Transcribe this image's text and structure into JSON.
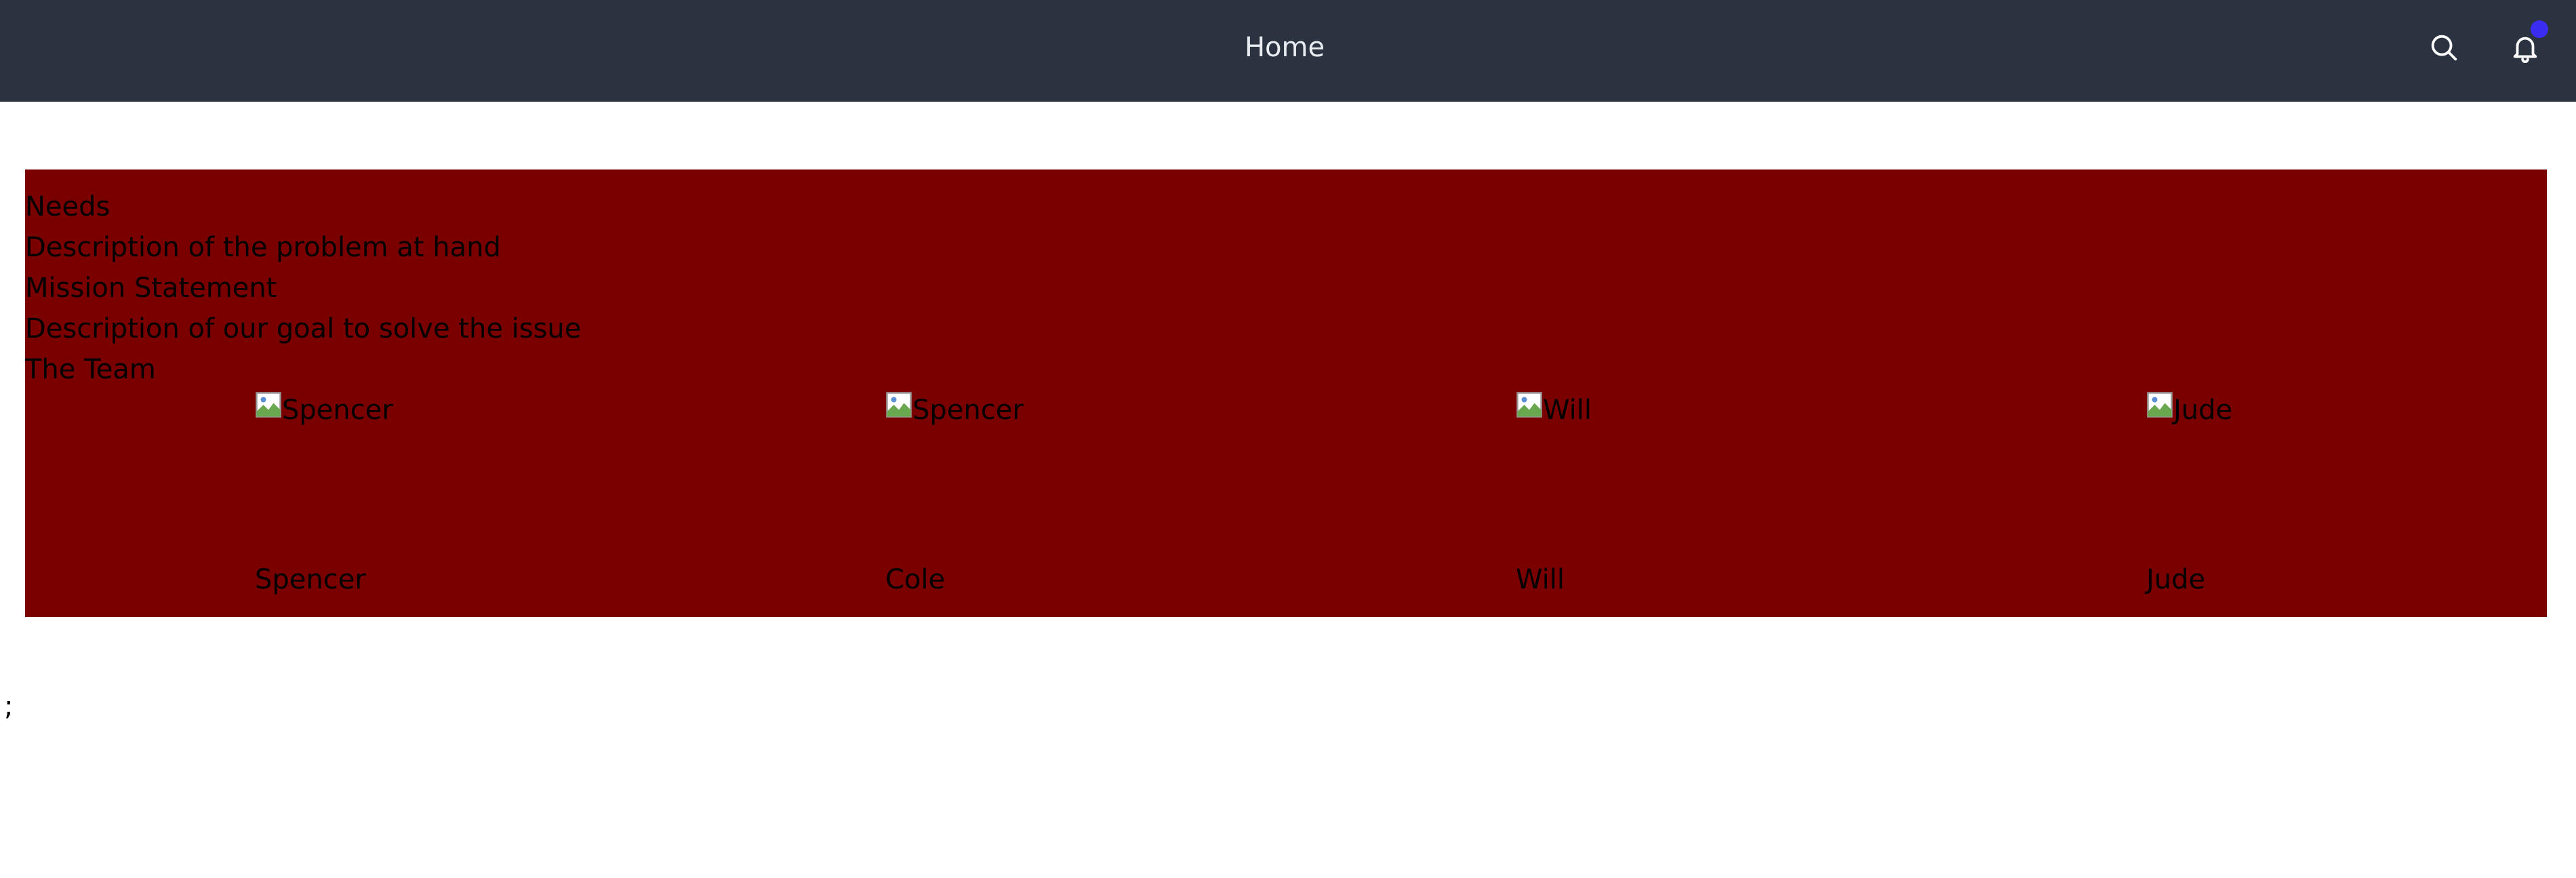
{
  "nav": {
    "title": "Home",
    "search_icon": "search-icon",
    "bell_icon": "bell-icon",
    "notification_dot_color": "#3a2cf0",
    "background_color": "#2b3340"
  },
  "panel": {
    "background_color": "#7a0000",
    "needs_heading": "Needs",
    "needs_text": "Description of the problem at hand",
    "mission_heading": "Mission Statement",
    "mission_text": "Description of our goal to solve the issue",
    "team_heading": "The Team",
    "members": [
      {
        "photo_alt": "Spencer",
        "name": "Spencer"
      },
      {
        "photo_alt": "Spencer",
        "name": "Cole"
      },
      {
        "photo_alt": "Will",
        "name": "Will"
      },
      {
        "photo_alt": "Jude",
        "name": "Jude"
      }
    ]
  },
  "trailing_text": ";"
}
